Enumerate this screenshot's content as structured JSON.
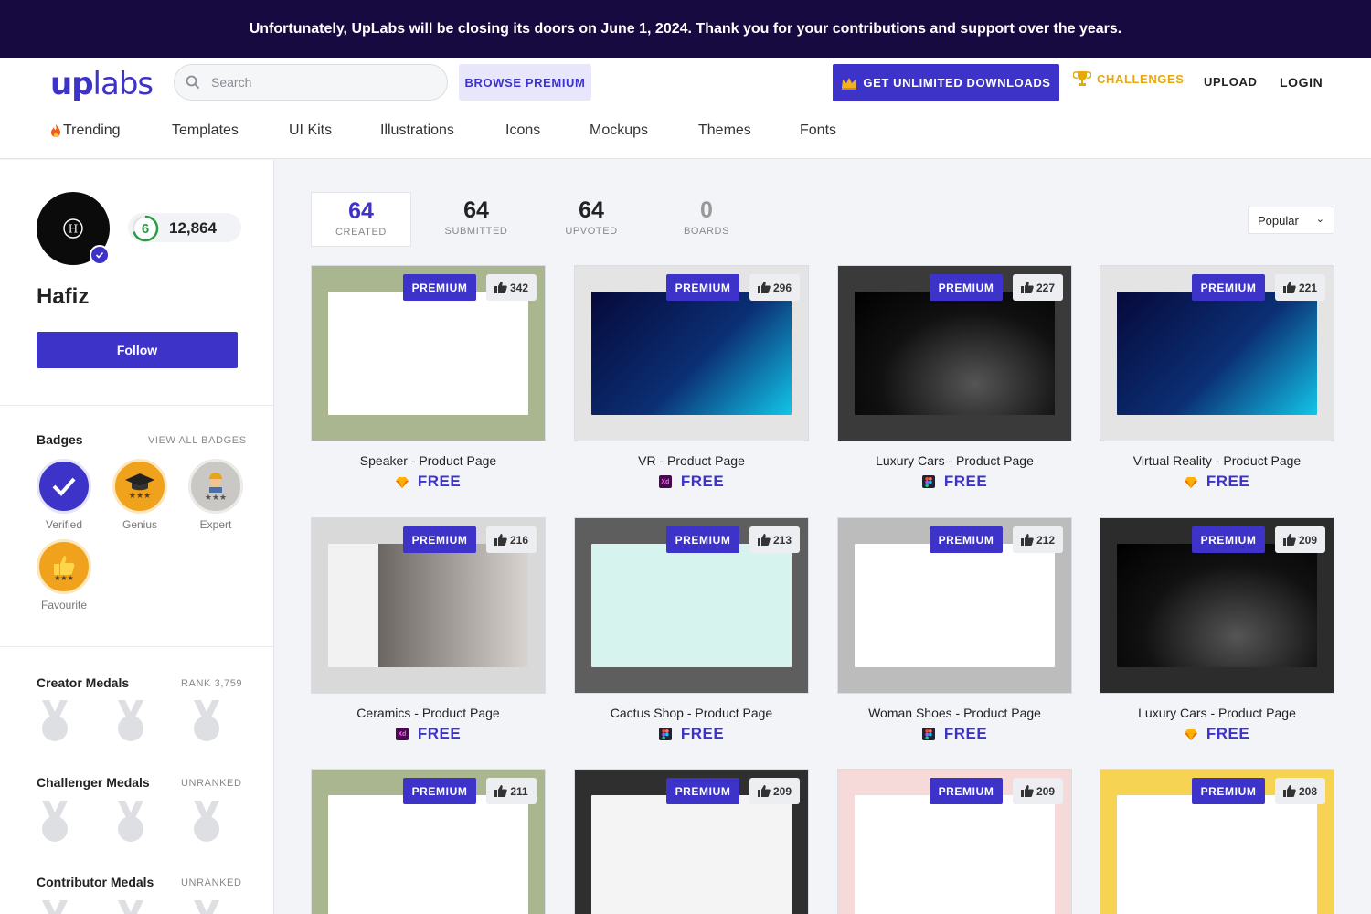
{
  "banner": {
    "text": "Unfortunately, UpLabs will be closing its doors on June 1, 2024. Thank you for your contributions and support over the years."
  },
  "header": {
    "logo_up": "up",
    "logo_labs": "labs",
    "search_placeholder": "Search",
    "browse_premium": "BROWSE PREMIUM",
    "get_unlimited": "GET UNLIMITED DOWNLOADS",
    "challenges": "CHALLENGES",
    "upload": "UPLOAD",
    "login": "LOGIN"
  },
  "categories": [
    "Trending",
    "Templates",
    "UI Kits",
    "Illustrations",
    "Icons",
    "Mockups",
    "Themes",
    "Fonts"
  ],
  "profile": {
    "level": "6",
    "points": "12,864",
    "name": "Hafiz",
    "follow": "Follow",
    "avatar_letter": "H"
  },
  "badges": {
    "title": "Badges",
    "view_all": "VIEW ALL BADGES",
    "items": [
      {
        "label": "Verified",
        "color": "#3d33c8"
      },
      {
        "label": "Genius",
        "color": "#f0a21c"
      },
      {
        "label": "Expert",
        "color": "#c9c8c5"
      },
      {
        "label": "Favourite",
        "color": "#f0a21c"
      }
    ]
  },
  "medals": [
    {
      "title": "Creator Medals",
      "rank": "RANK 3,759"
    },
    {
      "title": "Challenger Medals",
      "rank": "UNRANKED"
    },
    {
      "title": "Contributor Medals",
      "rank": "UNRANKED"
    }
  ],
  "stats": [
    {
      "num": "64",
      "cap": "CREATED"
    },
    {
      "num": "64",
      "cap": "SUBMITTED"
    },
    {
      "num": "64",
      "cap": "UPVOTED"
    },
    {
      "num": "0",
      "cap": "BOARDS"
    }
  ],
  "sort": {
    "selected": "Popular"
  },
  "card_labels": {
    "premium": "PREMIUM",
    "free": "FREE"
  },
  "cards": [
    {
      "title": "Speaker - Product Page",
      "likes": "342",
      "tool": "sketch",
      "bg": "#a9b68f"
    },
    {
      "title": "VR - Product Page",
      "likes": "296",
      "tool": "xd",
      "bg": "#e4e4e4"
    },
    {
      "title": "Luxury Cars - Product Page",
      "likes": "227",
      "tool": "figma",
      "bg": "#3a3a3a"
    },
    {
      "title": "Virtual Reality - Product Page",
      "likes": "221",
      "tool": "sketch",
      "bg": "#e4e4e4"
    },
    {
      "title": "Ceramics - Product Page",
      "likes": "216",
      "tool": "xd",
      "bg": "#d9d9d9"
    },
    {
      "title": "Cactus Shop - Product Page",
      "likes": "213",
      "tool": "figma",
      "bg": "#5e5e5e"
    },
    {
      "title": "Woman Shoes - Product Page",
      "likes": "212",
      "tool": "figma",
      "bg": "#bcbcbc"
    },
    {
      "title": "Luxury Cars - Product Page",
      "likes": "209",
      "tool": "sketch",
      "bg": "#2c2c2c"
    },
    {
      "title": "",
      "likes": "211",
      "tool": "",
      "bg": "#a9b68f"
    },
    {
      "title": "",
      "likes": "209",
      "tool": "",
      "bg": "#2f2f2f"
    },
    {
      "title": "",
      "likes": "209",
      "tool": "",
      "bg": "#f6dada"
    },
    {
      "title": "",
      "likes": "208",
      "tool": "",
      "bg": "#f6d352"
    }
  ]
}
